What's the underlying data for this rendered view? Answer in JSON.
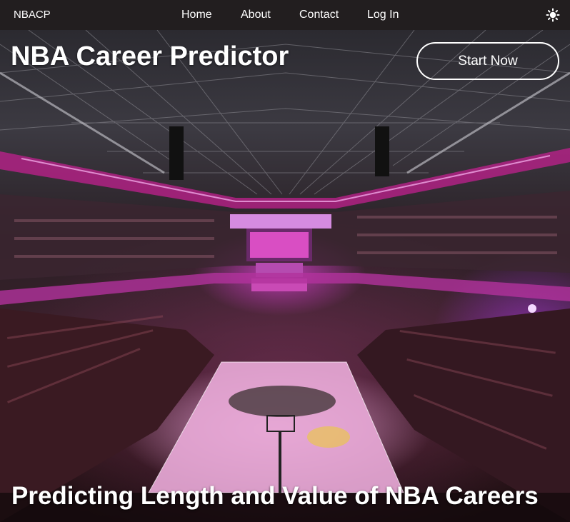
{
  "navbar": {
    "brand": "NBACP",
    "links": [
      "Home",
      "About",
      "Contact",
      "Log In"
    ],
    "theme_toggle_icon": "sun-icon"
  },
  "hero": {
    "title": "NBA Career Predictor",
    "cta_label": "Start Now",
    "subtitle": "Predicting Length and Value of NBA Careers",
    "background_image": "basketball-arena-photo"
  },
  "colors": {
    "navbar_bg": "#221e1f",
    "text": "#ffffff",
    "accent_magenta": "#d13cc8"
  }
}
